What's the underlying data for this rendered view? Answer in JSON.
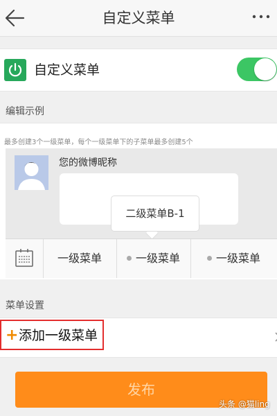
{
  "header": {
    "title": "自定义菜单"
  },
  "toggle_row": {
    "label": "自定义菜单",
    "enabled": true,
    "color": "#3cc664"
  },
  "example": {
    "section_label": "编辑示例",
    "note": "最多创建3个一级菜单，每个一级菜单下的子菜单最多创建5个",
    "nickname": "您的微博昵称",
    "submenu_popup": "二级菜单B-1",
    "menu_items": [
      "一级菜单",
      "一级菜单",
      "一级菜单"
    ]
  },
  "settings": {
    "section_label": "菜单设置",
    "add_label": "添加一级菜单",
    "highlight_color": "#e32d2d"
  },
  "publish_label": "发布",
  "watermark": "头条 @猫ling",
  "icons": [
    "back-arrow-icon",
    "more-icon",
    "power-icon",
    "keyboard-icon",
    "plus-icon",
    "chevron-right-icon"
  ]
}
